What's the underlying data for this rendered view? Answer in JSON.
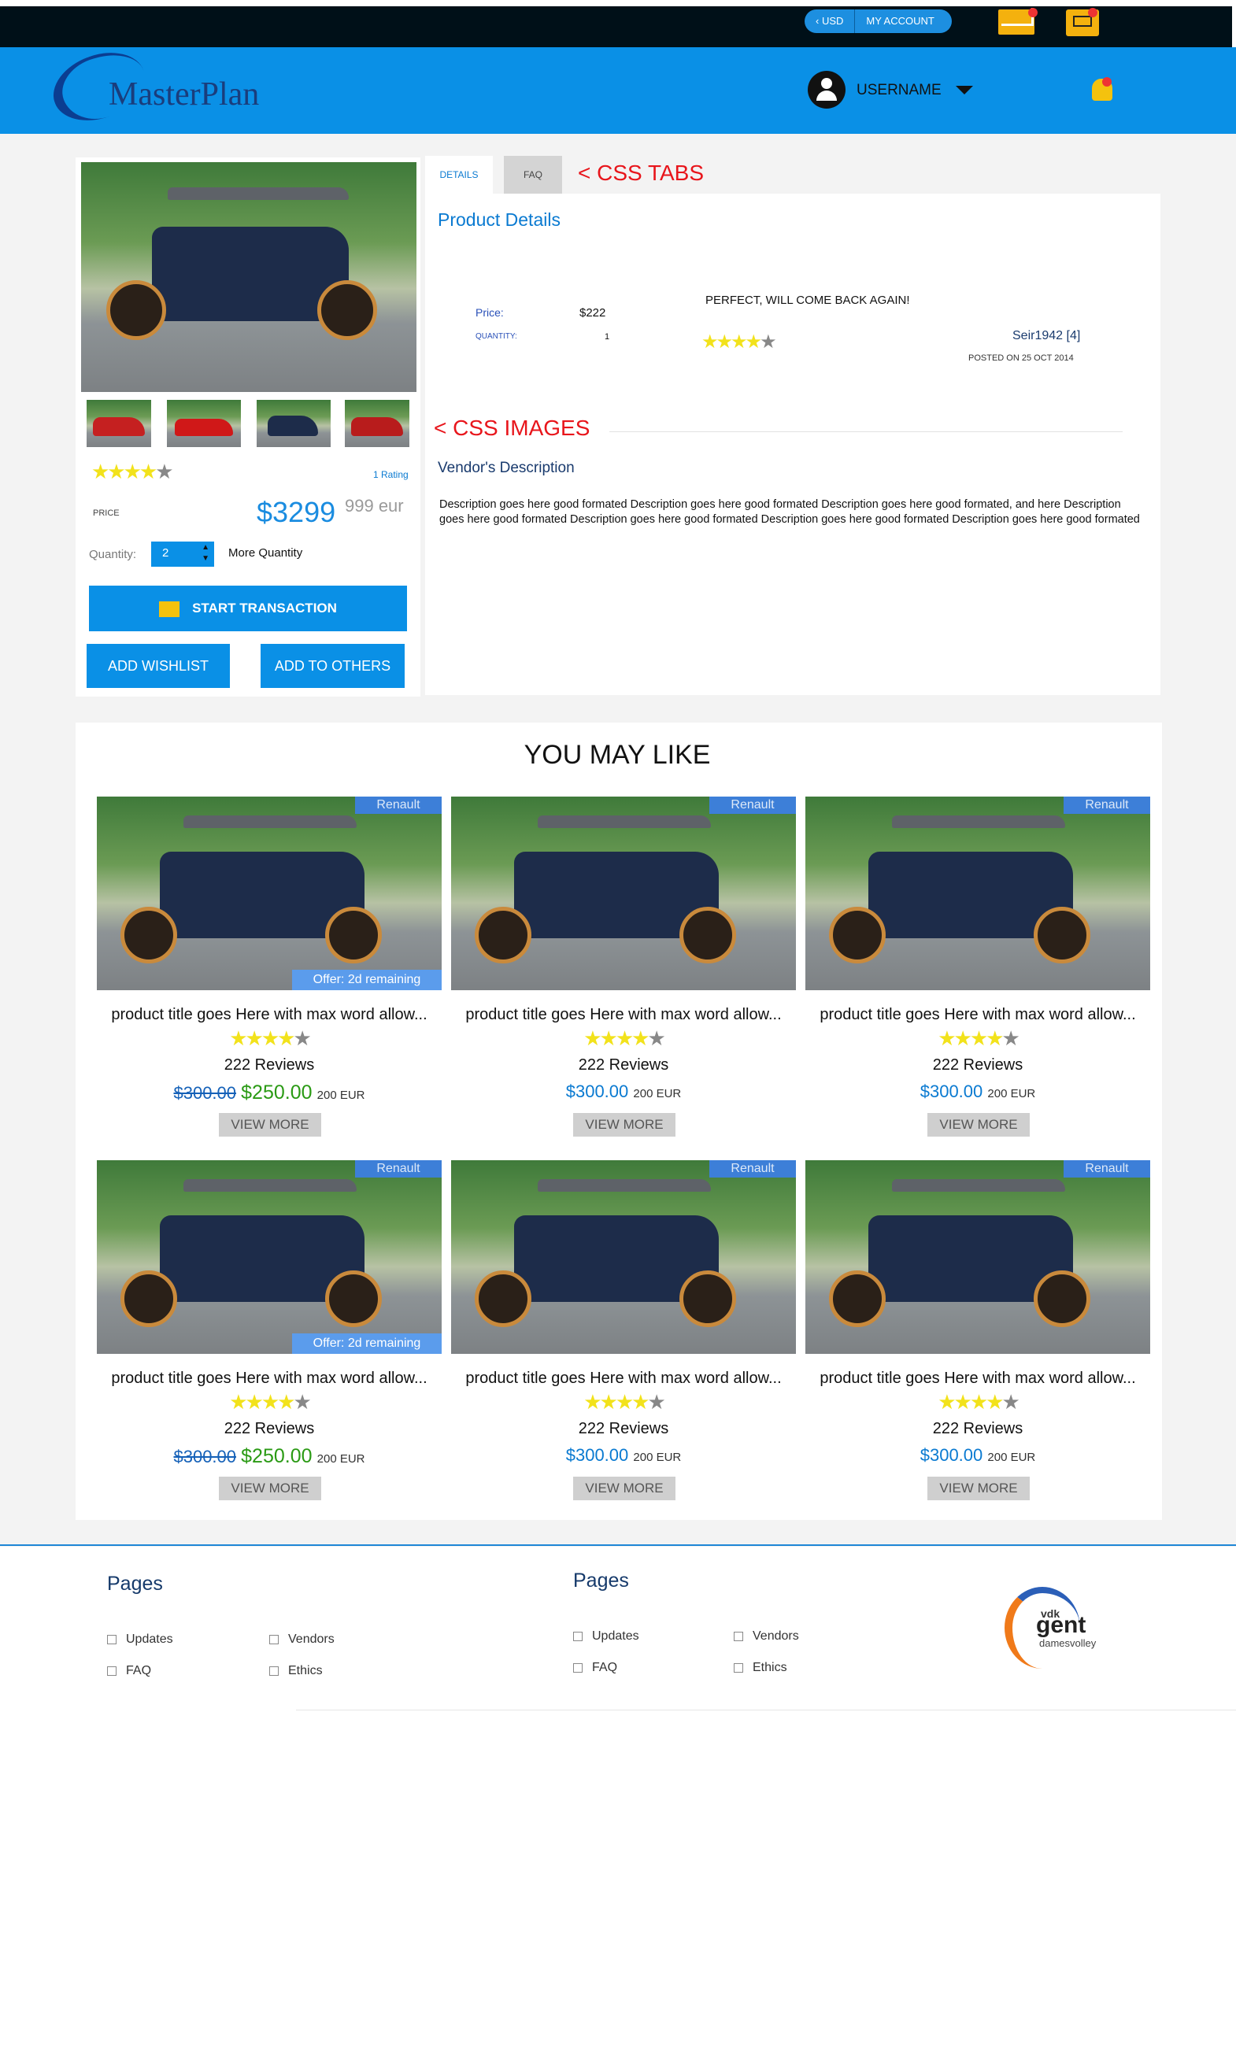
{
  "topbar": {
    "currency": "‹ USD",
    "account": "MY ACCOUNT",
    "mail_icon": "mail-icon",
    "cart_icon": "cart-icon"
  },
  "header": {
    "logo": "MasterPlan",
    "username": "USERNAME"
  },
  "tabs": [
    {
      "label": "DETAILS"
    },
    {
      "label": "FAQ"
    }
  ],
  "annotations": {
    "tabs": "<  CSS TABS",
    "images": "< CSS IMAGES"
  },
  "product": {
    "rating_label": "1 Rating",
    "price_label": "PRICE",
    "price": "$3299",
    "price_eur": "999 eur",
    "quantity_label": "Quantity:",
    "quantity_value": "2",
    "more_quantity": "More Quantity",
    "start_transaction": "START TRANSACTION",
    "add_wishlist": "ADD WISHLIST",
    "add_others": "ADD TO OTHERS"
  },
  "details": {
    "title": "Product Details",
    "price_label": "Price:",
    "price_value": "$222",
    "quantity_label": "QUANTITY:",
    "quantity_value": "1",
    "review_text": "PERFECT, WILL COME BACK AGAIN!",
    "reviewer": "Seir1942 [4]",
    "posted": "POSTED ON 25 OCT 2014",
    "vendor_title": "Vendor's Description",
    "vendor_text": "Description goes here good formated Description goes here good formated Description goes here good formated, and here Description goes here good formated Description goes here good formated Description goes here good formated Description goes here good formated"
  },
  "you_may_like": {
    "title": "YOU MAY LIKE",
    "cards": [
      {
        "badge": "Renault",
        "offer": "Offer: 2d remaining",
        "title": "product title goes Here with max word allow...",
        "reviews": "222 Reviews",
        "old_price": "$300.00",
        "price": "$250.00",
        "eur": "200 EUR",
        "button": "VIEW MORE"
      },
      {
        "badge": "Renault",
        "offer": "",
        "title": "product title goes Here with max word allow...",
        "reviews": "222 Reviews",
        "old_price": "",
        "price": "$300.00",
        "eur": "200 EUR",
        "button": "VIEW MORE"
      },
      {
        "badge": "Renault",
        "offer": "",
        "title": "product title goes Here with max word allow...",
        "reviews": "222 Reviews",
        "old_price": "",
        "price": "$300.00",
        "eur": "200 EUR",
        "button": "VIEW MORE"
      },
      {
        "badge": "Renault",
        "offer": "Offer: 2d remaining",
        "title": "product title goes Here with max word allow...",
        "reviews": "222 Reviews",
        "old_price": "$300.00",
        "price": "$250.00",
        "eur": "200 EUR",
        "button": "VIEW MORE"
      },
      {
        "badge": "Renault",
        "offer": "",
        "title": "product title goes Here with max word allow...",
        "reviews": "222 Reviews",
        "old_price": "",
        "price": "$300.00",
        "eur": "200 EUR",
        "button": "VIEW MORE"
      },
      {
        "badge": "Renault",
        "offer": "",
        "title": "product title goes Here with max word allow...",
        "reviews": "222 Reviews",
        "old_price": "",
        "price": "$300.00",
        "eur": "200 EUR",
        "button": "VIEW MORE"
      }
    ]
  },
  "footer": {
    "col1": {
      "title": "Pages",
      "links": [
        "Updates",
        "Vendors",
        "FAQ",
        "Ethics"
      ]
    },
    "col2": {
      "title": "Pages",
      "links": [
        "Updates",
        "Vendors",
        "FAQ",
        "Ethics"
      ]
    },
    "brand_top": "vdk",
    "brand_main": "gent",
    "brand_sub": "damesvolley"
  },
  "colors": {
    "brand_blue": "#0a90e6",
    "accent_red": "#e8151b",
    "star": "#f2e21b"
  }
}
